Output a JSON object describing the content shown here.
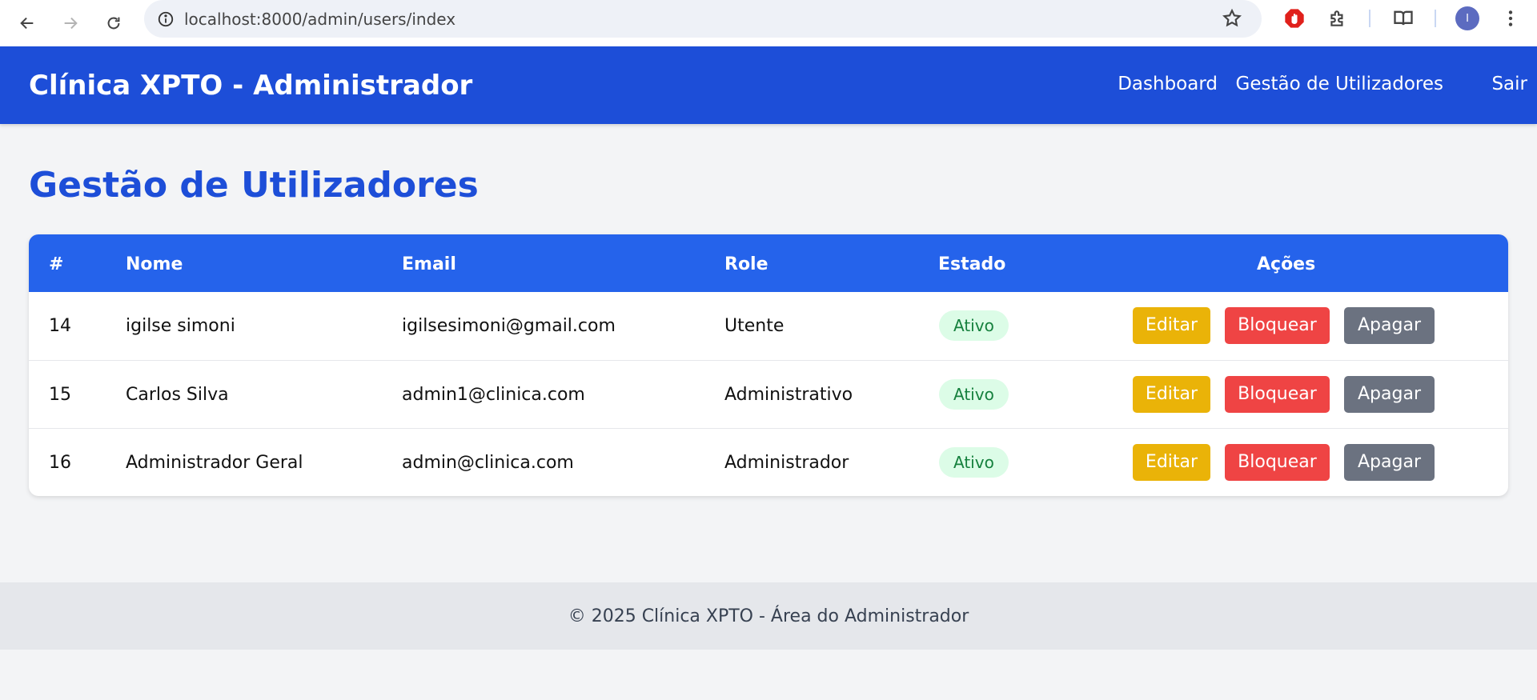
{
  "browser": {
    "url": "localhost:8000/admin/users/index",
    "avatar_letter": "I",
    "icons": [
      "back-arrow-icon",
      "forward-arrow-icon",
      "reload-icon",
      "site-info-icon",
      "bookmark-star-icon",
      "adblock-icon",
      "extensions-puzzle-icon",
      "reading-mode-icon",
      "profile-avatar",
      "more-menu-icon"
    ]
  },
  "header": {
    "brand": "Clínica XPTO - Administrador",
    "nav": [
      "Dashboard",
      "Gestão de Utilizadores",
      "Sair"
    ],
    "background": "#1d4ed8"
  },
  "main": {
    "title": "Gestão de Utilizadores",
    "table": {
      "columns": [
        "#",
        "Nome",
        "Email",
        "Role",
        "Estado",
        "Ações"
      ],
      "rows": [
        {
          "id": "14",
          "name": "igilse simoni",
          "email": "igilsesimoni@gmail.com",
          "role": "Utente",
          "status": "Ativo",
          "actions": [
            "Editar",
            "Bloquear",
            "Apagar"
          ]
        },
        {
          "id": "15",
          "name": "Carlos Silva",
          "email": "admin1@clinica.com",
          "role": "Administrativo",
          "status": "Ativo",
          "actions": [
            "Editar",
            "Bloquear",
            "Apagar"
          ]
        },
        {
          "id": "16",
          "name": "Administrador Geral",
          "email": "admin@clinica.com",
          "role": "Administrador",
          "status": "Ativo",
          "actions": [
            "Editar",
            "Bloquear",
            "Apagar"
          ]
        }
      ]
    }
  },
  "footer": {
    "text": "© 2025 Clínica XPTO - Área do Administrador"
  },
  "colors": {
    "header_bg": "#1d4ed8",
    "table_header_bg": "#2563eb",
    "edit_button": "#eab308",
    "block_button": "#ef4444",
    "delete_button": "#6b7280",
    "status_badge_bg": "#dcfce7",
    "status_badge_text": "#15803d"
  }
}
